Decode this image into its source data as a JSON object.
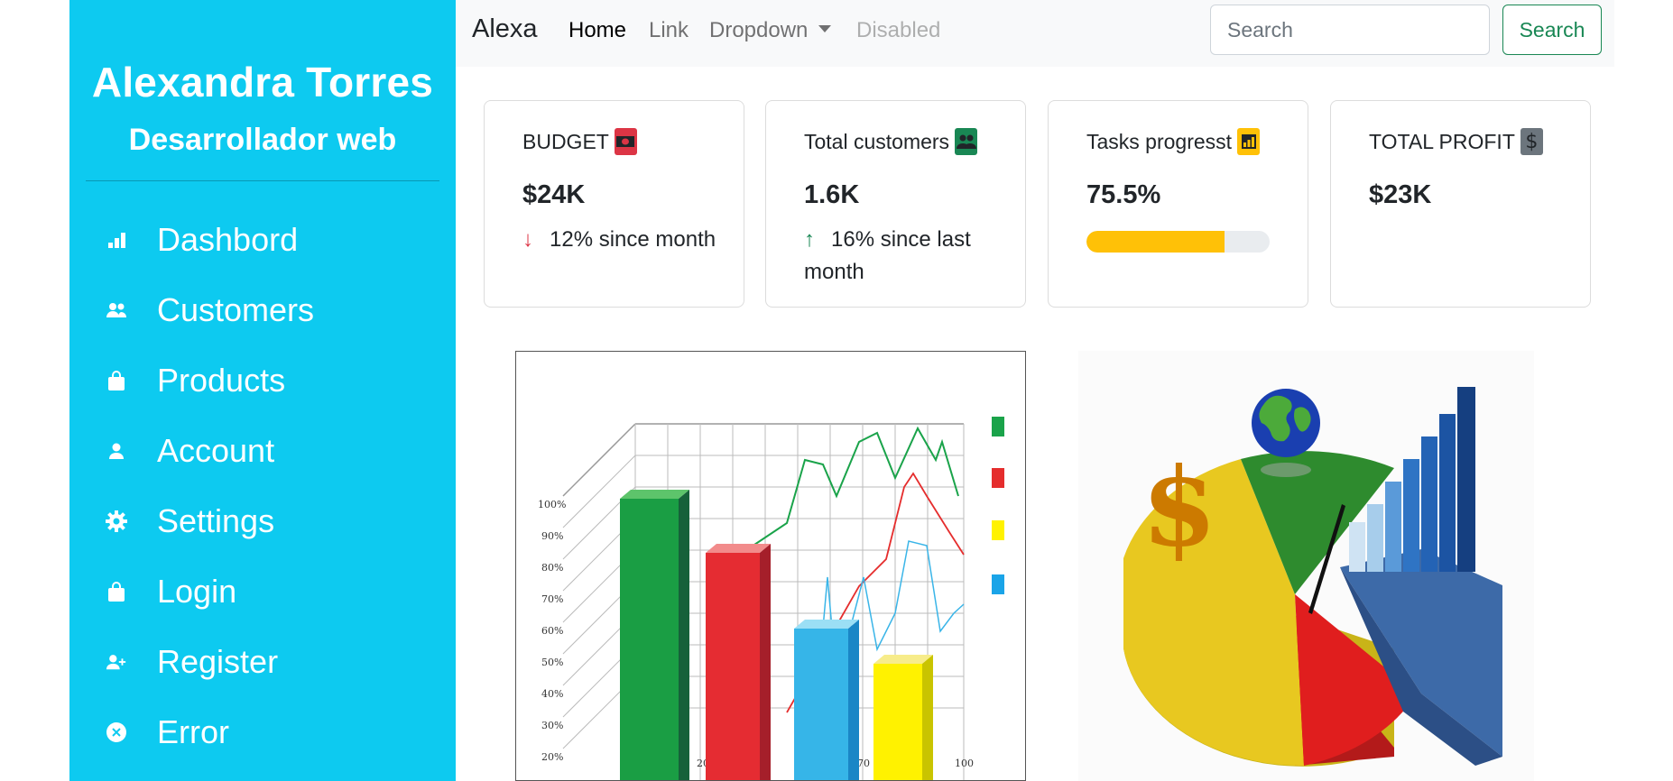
{
  "sidebar": {
    "name": "Alexandra Torres",
    "role": "Desarrollador web",
    "items": [
      {
        "label": "Dashbord",
        "icon": "bar-chart-icon"
      },
      {
        "label": "Customers",
        "icon": "people-icon"
      },
      {
        "label": "Products",
        "icon": "bag-icon"
      },
      {
        "label": "Account",
        "icon": "person-icon"
      },
      {
        "label": "Settings",
        "icon": "gear-icon"
      },
      {
        "label": "Login",
        "icon": "bag-icon"
      },
      {
        "label": "Register",
        "icon": "person-add-icon"
      },
      {
        "label": "Error",
        "icon": "x-circle-icon"
      }
    ]
  },
  "navbar": {
    "brand": "Alexa",
    "links": {
      "home": "Home",
      "link": "Link",
      "dropdown": "Dropdown",
      "disabled": "Disabled"
    },
    "search_placeholder": "Search",
    "search_button": "Search"
  },
  "cards": {
    "budget": {
      "title": "BUDGET",
      "value": "$24K",
      "arrow": "↓",
      "delta": "12% since month",
      "color": "#dc3545",
      "icon": "cash-icon"
    },
    "customers": {
      "title": "Total customers",
      "value": "1.6K",
      "arrow": "↑",
      "delta": "16% since last month",
      "color": "#198754",
      "icon": "people-icon"
    },
    "tasks": {
      "title": "Tasks progresst",
      "value": "75.5%",
      "progress": 0.755,
      "color": "#ffc107",
      "icon": "bar-chart-icon"
    },
    "profit": {
      "title": "TOTAL PROFIT",
      "value": "$23K",
      "color": "#6c757d",
      "icon": "dollar-icon"
    }
  },
  "images": {
    "bar_chart_ticks": [
      "100%",
      "90%",
      "80%",
      "70%",
      "60%",
      "50%",
      "40%",
      "30%",
      "20%"
    ],
    "bar_chart_xticks": [
      "20",
      "70",
      "100"
    ],
    "pie_symbol": "$"
  }
}
